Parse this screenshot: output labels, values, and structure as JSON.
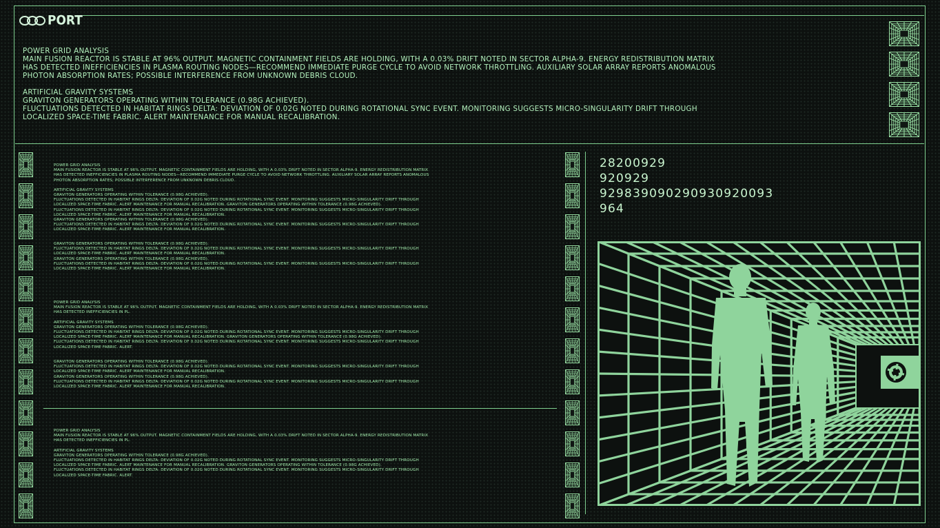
{
  "header": {
    "logo_text": "PORT"
  },
  "top_panel": {
    "section1_title": "Power Grid Analysis",
    "section1_line1": "Main fusion reactor is stable at 96% output. Magnetic containment fields are holding, with a 0.03% drift noted in Sector Alpha-9. Energy redistribution matrix",
    "section1_line2": "has detected inefficiencies in plasma routing nodes—recommend immediate purge cycle to avoid network throttling. Auxiliary solar array reports anomalous",
    "section1_line3": "photon absorption rates; possible interference from unknown debris cloud.",
    "section2_title": "Artificial Gravity Systems",
    "section2_line1": "Graviton generators operating within tolerance (0.98G achieved).",
    "section2_line2": "Fluctuations detected in Habitat Rings Delta: deviation of 0.02G noted during rotational sync event. Monitoring suggests micro-singularity drift through",
    "section2_line3": "localized space-time fabric. Alert maintenance for manual recalibration."
  },
  "log_blocks": {
    "b1": {
      "l1": "Power Grid Analysis",
      "l2": "Main fusion reactor is stable at 96% output. Magnetic containment fields are holding, with a 0.03% drift noted in Sector Alpha-9. Energy redistribution matrix",
      "l3": "has detected inefficiencies in plasma routing nodes—recommend immediate purge cycle to avoid network throttling. Auxiliary solar array reports anomalous",
      "l4": "photon absorption rates; possible interference from unknown debris cloud.",
      "l5": "Artificial Gravity Systems",
      "l6": "Graviton generators operating within tolerance (0.98G achieved).",
      "l7": "Fluctuations detected in Habitat Rings Delta: deviation of 0.02G noted during rotational sync event. Monitoring suggests micro-singularity drift through",
      "l8": "localized space-time fabric. Alert maintenance for manual recalibration. Graviton generators operating within tolerance (0.98G achieved).",
      "l9": "Fluctuations detected in Habitat Rings Delta: deviation of 0.02G noted during rotational sync event. Monitoring suggests micro-singularity drift through",
      "l10": "localized space-time fabric. Alert maintenance for manual recalibration.",
      "l11": "Graviton generators operating within tolerance (0.98G achieved).",
      "l12": "Fluctuations detected in Habitat Rings Delta: deviation of 0.02G noted during rotational sync event. Monitoring suggests micro-singularity drift through",
      "l13": "localized space-time fabric. Alert maintenance for manual recalibration."
    },
    "b2": {
      "l1": "Graviton generators operating within tolerance (0.98G achieved).",
      "l2": "Fluctuations detected in Habitat Rings Delta: deviation of 0.02G noted during rotational sync event. Monitoring suggests micro-singularity drift through",
      "l3": "localized space-time fabric. Alert maintenance for manual recalibration.",
      "l4": "Graviton generators operating within tolerance (0.98G achieved).",
      "l5": "Fluctuations detected in Habitat Rings Delta: deviation of 0.02G noted during rotational sync event. Monitoring suggests micro-singularity drift through",
      "l6": "localized space-time fabric. Alert maintenance for manual recalibration."
    },
    "b3": {
      "l1": "Power Grid Analysis",
      "l2": "Main fusion reactor is stable at 96% output. Magnetic containment fields are holding, with a 0.03% drift noted in Sector Alpha-9. Energy redistribution matrix",
      "l3": "has detected inefficiencies in pl.",
      "l4": "Artificial Gravity Systems",
      "l5": "Graviton generators operating within tolerance (0.98G achieved).",
      "l6": "Fluctuations detected in Habitat Rings Delta: deviation of 0.02G noted during rotational sync event. Monitoring suggests micro-singularity drift through",
      "l7": "localized space-time fabric. Alert maintenance for manual recalibration. Graviton generators operating within tolerance (0.98G achieved).",
      "l8": "Fluctuations detected in Habitat Rings Delta: deviation of 0.02G noted during rotational sync event. Monitoring suggests micro-singularity drift through",
      "l9": "localized space-time fabric. Alert."
    },
    "b4": {
      "l1": "Graviton generators operating within tolerance (0.98G achieved).",
      "l2": "Fluctuations detected in Habitat Rings Delta: deviation of 0.02G noted during rotational sync event. Monitoring suggests micro-singularity drift through",
      "l3": "localized space-time fabric. Alert maintenance for manual recalibration.",
      "l4": "Graviton generators operating within tolerance (0.98G achieved).",
      "l5": "Fluctuations detected in Habitat Rings Delta: deviation of 0.02G noted during rotational sync event. Monitoring suggests micro-singularity drift through",
      "l6": "localized space-time fabric. Alert maintenance for manual recalibration."
    },
    "b5": {
      "l1": "Power Grid Analysis",
      "l2": "Main fusion reactor is stable at 96% output. Magnetic containment fields are holding, with a 0.03% drift noted in Sector Alpha-9. Energy redistribution matrix",
      "l3": "has detected inefficiencies in pl.",
      "l4": "Artificial Gravity Systems",
      "l5": "Graviton generators operating within tolerance (0.98G achieved).",
      "l6": "Fluctuations detected in Habitat Rings Delta: deviation of 0.02G noted during rotational sync event. Monitoring suggests micro-singularity drift through",
      "l7": "localized space-time fabric. Alert maintenance for manual recalibration. Graviton generators operating within tolerance (0.98G achieved).",
      "l8": "Fluctuations detected in Habitat Rings Delta: deviation of 0.02G noted during rotational sync event. Monitoring suggests micro-singularity drift through",
      "l9": "localized space-time fabric. Alert."
    }
  },
  "readout": {
    "n1": "28200929",
    "n2": "920929",
    "n3": "929839090290930920093",
    "n4": "964"
  },
  "colors": {
    "accent": "#7fd08f",
    "text": "#a6f0b0",
    "figure_fill": "#8fd49c",
    "background": "#0d110f"
  },
  "icons": {
    "tile": "perspective-grid-icon",
    "vault": "vault-door-icon"
  }
}
